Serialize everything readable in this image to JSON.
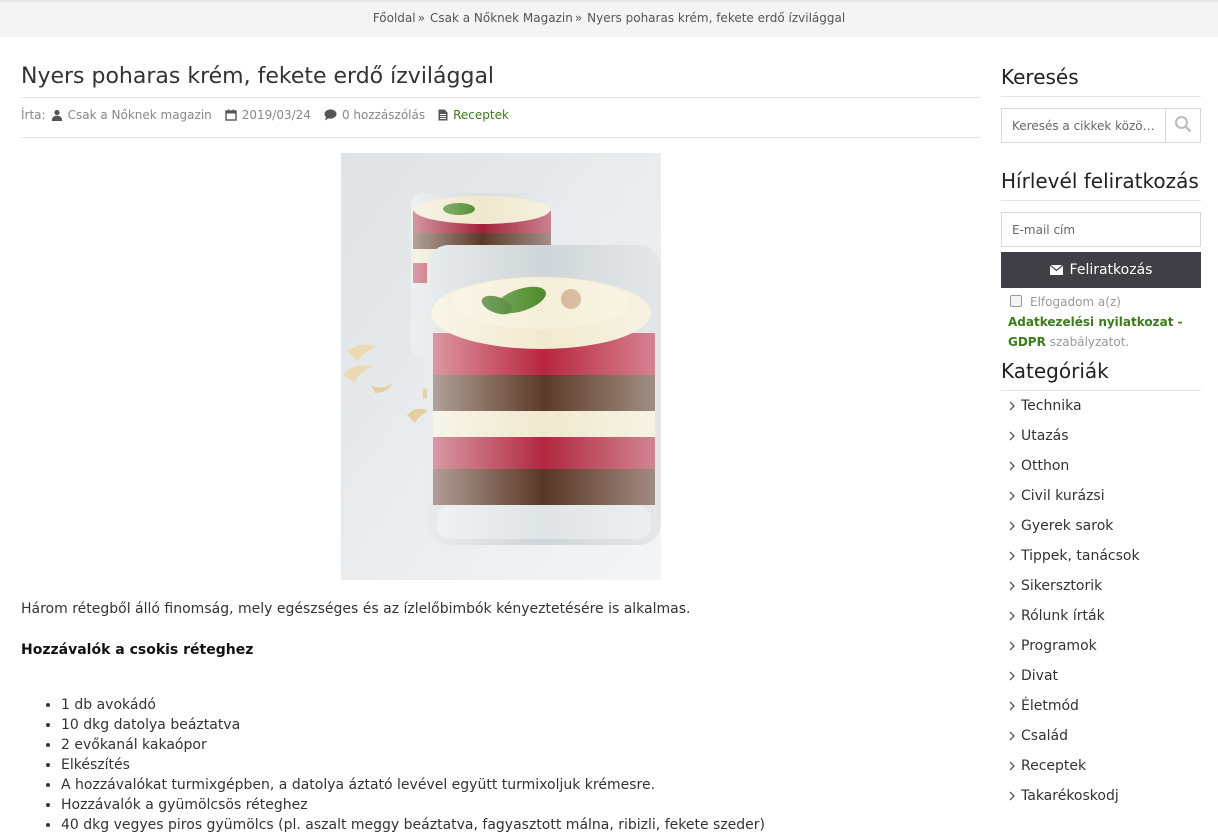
{
  "breadcrumb": {
    "home": "Főoldal",
    "section": "Csak a Nőknek Magazin",
    "current": "Nyers poharas krém, fekete erdő ízvilággal",
    "separator": "»"
  },
  "article": {
    "title": "Nyers poharas krém, fekete erdő ízvilággal",
    "meta": {
      "author_prefix": "Írta:",
      "author": "Csak a Nőknek magazin",
      "date": "2019/03/24",
      "comments": "0 hozzászólás",
      "category": "Receptek"
    },
    "intro": "Három rétegből álló finomság, mely egészséges és az ízlelőbimbók kényeztetésére is alkalmas.",
    "subheading": "Hozzávalók a csokis réteghez",
    "list": [
      "1 db avokádó",
      "10 dkg datolya beáztatva",
      "2 evőkanál kakaópor",
      "Elkészítés",
      "A hozzávalókat turmixgépben, a datolya áztató levével együtt turmixoljuk krémesre.",
      "Hozzávalók a gyümölcsös réteghez",
      "40 dkg vegyes piros gyümölcs (pl. aszalt meggy beáztatva, fagyasztott málna, ribizli, fekete szeder)"
    ]
  },
  "sidebar": {
    "search": {
      "title": "Keresés",
      "placeholder": "Keresés a cikkek között..."
    },
    "newsletter": {
      "title": "Hírlevél feliratkozás",
      "email_placeholder": "E-mail cím",
      "button": "Feliratkozás",
      "consent_before": "Elfogadom a(z)",
      "consent_link": "Adatkezelési nyilatkozat - GDPR",
      "consent_after": "szabályzatot."
    },
    "categories": {
      "title": "Kategóriák",
      "items": [
        "Technika",
        "Utazás",
        "Otthon",
        "Civil kurázsi",
        "Gyerek sarok",
        "Tippek, tanácsok",
        "Sikersztorik",
        "Rólunk írták",
        "Programok",
        "Divat",
        "Életmód",
        "Család",
        "Receptek",
        "Takarékoskodj"
      ]
    }
  },
  "colors": {
    "accent_green": "#3d7a1c",
    "button_dark": "#3f3f45",
    "topbar": "#f4f4f4"
  },
  "icons": {
    "author": "user-icon",
    "date": "calendar-icon",
    "comments": "comment-icon",
    "category": "document-icon",
    "search": "search-icon",
    "subscribe": "envelope-icon",
    "category_item": "chevron-right-icon"
  }
}
